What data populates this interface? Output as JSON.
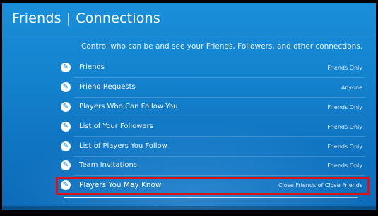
{
  "header": {
    "title_main": "Friends",
    "title_separator": "|",
    "title_section": "Connections"
  },
  "subtitle": "Control who can be and see your Friends, Followers, and other connections.",
  "settings": [
    {
      "icon": "wrench-icon",
      "label": "Friends",
      "value": "Friends Only"
    },
    {
      "icon": "wrench-icon",
      "label": "Friend Requests",
      "value": "Anyone"
    },
    {
      "icon": "wrench-icon",
      "label": "Players Who Can Follow You",
      "value": "Friends Only"
    },
    {
      "icon": "wrench-icon",
      "label": "List of Your Followers",
      "value": "Friends Only"
    },
    {
      "icon": "wrench-icon",
      "label": "List of Players You Follow",
      "value": "Friends Only"
    },
    {
      "icon": "wrench-icon",
      "label": "Team Invitations",
      "value": "Friends Only"
    },
    {
      "icon": "wrench-icon",
      "label": "Players You May Know",
      "value": "Close Friends of Close Friends"
    }
  ],
  "colors": {
    "background": "#1483cf",
    "highlight_border": "#e0101a",
    "text": "#ffffff"
  }
}
